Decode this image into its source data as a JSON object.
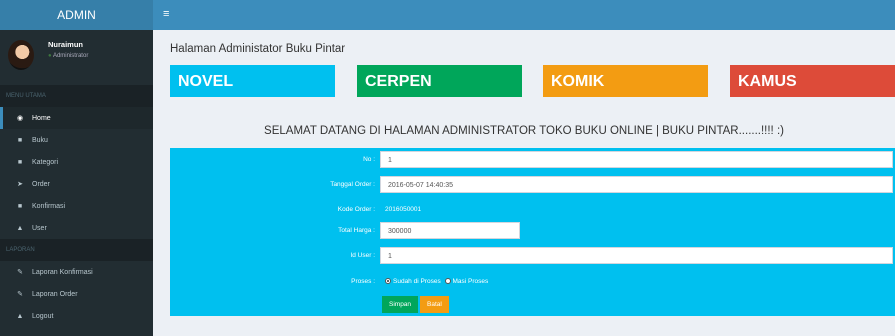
{
  "header": {
    "brand": "ADMIN",
    "toggle_icon": "hamburger-icon"
  },
  "sidebar": {
    "user": {
      "name": "Nuraimun",
      "status": "Administrator"
    },
    "menu_utama_label": "MENU UTAMA",
    "items": [
      {
        "label": "Home",
        "icon": "dashboard-icon"
      },
      {
        "label": "Buku",
        "icon": "folder-icon"
      },
      {
        "label": "Kategori",
        "icon": "folder-icon"
      },
      {
        "label": "Order",
        "icon": "send-icon"
      },
      {
        "label": "Konfirmasi",
        "icon": "folder-icon"
      },
      {
        "label": "User",
        "icon": "user-icon"
      }
    ],
    "laporan_label": "LAPORAN",
    "laporan_items": [
      {
        "label": "Laporan Konfirmasi",
        "icon": "edit-icon"
      },
      {
        "label": "Laporan Order",
        "icon": "edit-icon"
      },
      {
        "label": "Logout",
        "icon": "user-icon"
      }
    ]
  },
  "main": {
    "title": "Halaman Administator Buku Pintar",
    "categories": [
      {
        "label": "NOVEL",
        "color": "#00c0ef"
      },
      {
        "label": "CERPEN",
        "color": "#00a65a"
      },
      {
        "label": "KOMIK",
        "color": "#f39c12"
      },
      {
        "label": "KAMUS",
        "color": "#dd4b39"
      }
    ],
    "welcome": "SELAMAT DATANG DI HALAMAN ADMINISTRATOR TOKO BUKU ONLINE | BUKU PINTAR.......!!!! :)"
  },
  "form": {
    "no_label": "No :",
    "no_value": "1",
    "tanggal_label": "Tanggal Order :",
    "tanggal_value": "2016-05-07 14:40:35",
    "kode_label": "Kode Order :",
    "kode_value": "2016050001",
    "total_label": "Total Harga :",
    "total_value": "300000",
    "iduser_label": "Id User :",
    "iduser_value": "1",
    "proses_label": "Proses :",
    "proses_option_1": "Sudah di Proses",
    "proses_option_2": "Masi Proses",
    "simpan": "Simpan",
    "batal": "Batal"
  }
}
